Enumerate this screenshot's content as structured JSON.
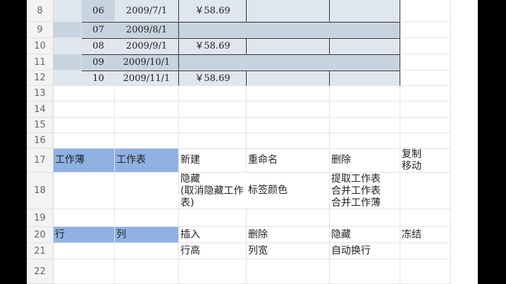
{
  "row_headers": [
    "8",
    "9",
    "10",
    "11",
    "12",
    "13",
    "14",
    "15",
    "16",
    "17",
    "18",
    "19",
    "20",
    "21",
    "22"
  ],
  "data_rows": [
    {
      "no": "06",
      "date": "2009/7/1",
      "amount": "￥58.69"
    },
    {
      "no": "07",
      "date": "2009/8/1",
      "amount": ""
    },
    {
      "no": "08",
      "date": "2009/9/1",
      "amount": "￥58.69"
    },
    {
      "no": "09",
      "date": "2009/10/1",
      "amount": ""
    },
    {
      "no": "10",
      "date": "2009/11/1",
      "amount": "￥58.69"
    }
  ],
  "row17": {
    "a": "工作薄",
    "b": "工作表",
    "c": "新建",
    "d": "重命名",
    "e": "删除",
    "f": "复制\n移动"
  },
  "row18": {
    "c": "隐藏\n(取消隐藏工作\n表)",
    "d": "标签颜色",
    "e": "提取工作表\n合并工作表\n合并工作薄"
  },
  "row20": {
    "a": "行",
    "b": "列",
    "c": "插入",
    "d": "删除",
    "e": "隐藏",
    "f": "冻结"
  },
  "row21": {
    "c": "行高",
    "d": "列宽",
    "e": "自动换行"
  }
}
